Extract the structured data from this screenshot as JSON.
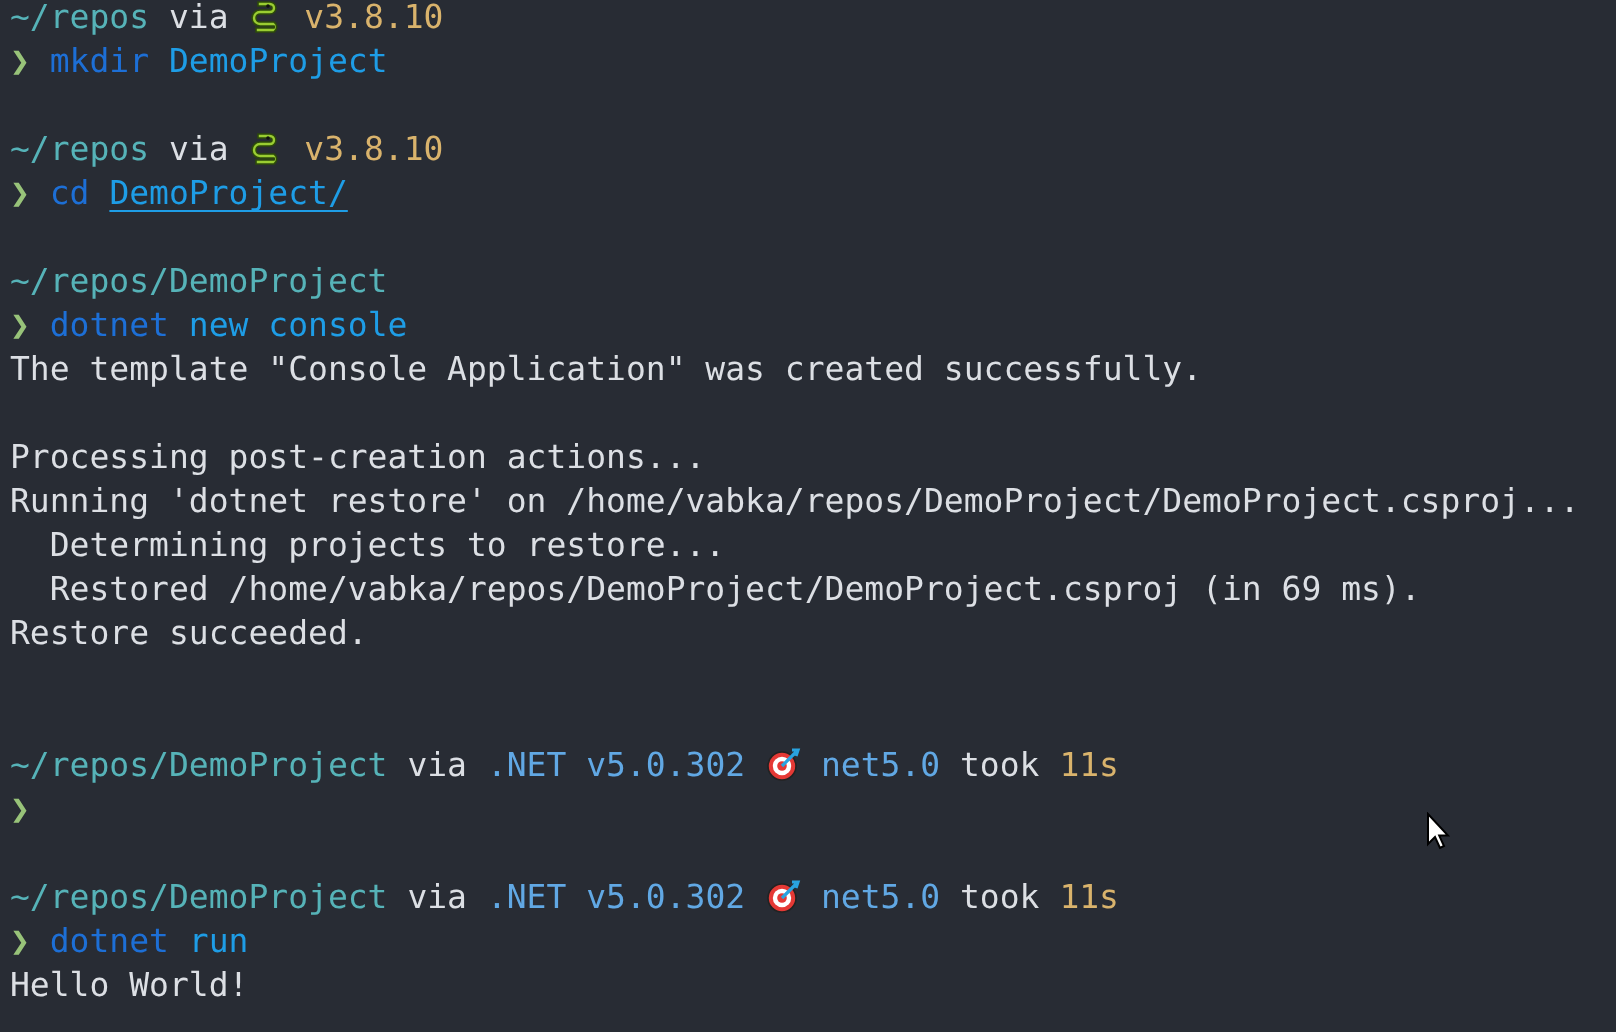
{
  "terminal": {
    "lines": [
      {
        "kind": "prompt",
        "segments": [
          {
            "kind": "path",
            "text": "~/repos"
          },
          {
            "kind": "plain",
            "text": "via"
          },
          {
            "kind": "snake"
          },
          {
            "kind": "version",
            "text": "v3.8.10"
          }
        ]
      },
      {
        "kind": "command",
        "segments": [
          {
            "kind": "arrow",
            "text": "❯"
          },
          {
            "kind": "cmd",
            "text": "mkdir"
          },
          {
            "kind": "arg",
            "text": "DemoProject"
          }
        ]
      },
      {
        "kind": "blank"
      },
      {
        "kind": "prompt",
        "segments": [
          {
            "kind": "path",
            "text": "~/repos"
          },
          {
            "kind": "plain",
            "text": "via"
          },
          {
            "kind": "snake"
          },
          {
            "kind": "version",
            "text": "v3.8.10"
          }
        ]
      },
      {
        "kind": "command",
        "segments": [
          {
            "kind": "arrow",
            "text": "❯"
          },
          {
            "kind": "cmd",
            "text": "cd"
          },
          {
            "kind": "link",
            "text": "DemoProject/"
          }
        ]
      },
      {
        "kind": "blank"
      },
      {
        "kind": "prompt",
        "segments": [
          {
            "kind": "path",
            "text": "~/repos/DemoProject"
          }
        ]
      },
      {
        "kind": "command",
        "segments": [
          {
            "kind": "arrow",
            "text": "❯"
          },
          {
            "kind": "cmd",
            "text": "dotnet"
          },
          {
            "kind": "arg",
            "text": "new"
          },
          {
            "kind": "arg",
            "text": "console"
          }
        ]
      },
      {
        "kind": "output",
        "text": "The template \"Console Application\" was created successfully."
      },
      {
        "kind": "blank"
      },
      {
        "kind": "output",
        "text": "Processing post-creation actions..."
      },
      {
        "kind": "output",
        "text": "Running 'dotnet restore' on /home/vabka/repos/DemoProject/DemoProject.csproj..."
      },
      {
        "kind": "output",
        "text": "  Determining projects to restore..."
      },
      {
        "kind": "output",
        "text": "  Restored /home/vabka/repos/DemoProject/DemoProject.csproj (in 69 ms)."
      },
      {
        "kind": "output",
        "text": "Restore succeeded."
      },
      {
        "kind": "blank"
      },
      {
        "kind": "blank"
      },
      {
        "kind": "prompt",
        "segments": [
          {
            "kind": "path",
            "text": "~/repos/DemoProject"
          },
          {
            "kind": "plain",
            "text": "via"
          },
          {
            "kind": "tool",
            "text": ".NET v5.0.302"
          },
          {
            "kind": "target"
          },
          {
            "kind": "tool",
            "text": "net5.0"
          },
          {
            "kind": "plain",
            "text": "took"
          },
          {
            "kind": "version",
            "text": "11s"
          }
        ]
      },
      {
        "kind": "command",
        "segments": [
          {
            "kind": "arrow",
            "text": "❯"
          }
        ]
      },
      {
        "kind": "blank"
      },
      {
        "kind": "prompt",
        "segments": [
          {
            "kind": "path",
            "text": "~/repos/DemoProject"
          },
          {
            "kind": "plain",
            "text": "via"
          },
          {
            "kind": "tool",
            "text": ".NET v5.0.302"
          },
          {
            "kind": "target"
          },
          {
            "kind": "tool",
            "text": "net5.0"
          },
          {
            "kind": "plain",
            "text": "took"
          },
          {
            "kind": "version",
            "text": "11s"
          }
        ]
      },
      {
        "kind": "command",
        "segments": [
          {
            "kind": "arrow",
            "text": "❯"
          },
          {
            "kind": "cmd",
            "text": "dotnet"
          },
          {
            "kind": "arg",
            "text": "run"
          }
        ]
      },
      {
        "kind": "output",
        "text": "Hello World!"
      }
    ]
  }
}
